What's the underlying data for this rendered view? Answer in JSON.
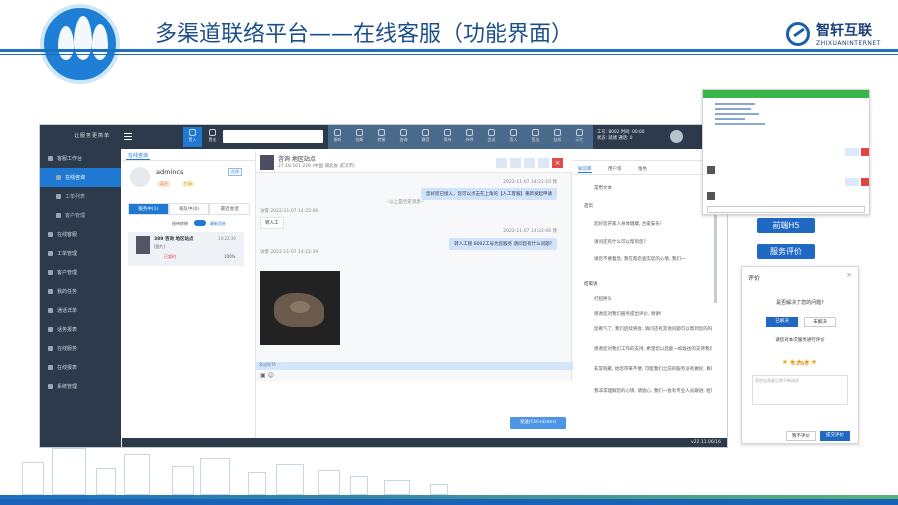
{
  "header": {
    "title": "多渠道联络平台——在线客服（功能界面）",
    "brand_cn": "智轩互联",
    "brand_en": "ZHIXUANINTERNET"
  },
  "app": {
    "brand": "让服务更简单",
    "topbar": {
      "buttons": [
        "置入",
        "置出"
      ],
      "tools": [
        "接听",
        "挂断",
        "转接",
        "咨询",
        "静音",
        "保持",
        "外呼",
        "会议",
        "签入",
        "签出",
        "挂机",
        "示忙"
      ],
      "status_lines": [
        "工号: 8002  时间: 00:00",
        "状态: 就绪  通话: 0"
      ]
    },
    "sidebar": [
      {
        "label": "客服工作台",
        "active": false,
        "sub": false
      },
      {
        "label": "在线咨询",
        "active": true,
        "sub": true
      },
      {
        "label": "工单列表",
        "active": false,
        "sub": true
      },
      {
        "label": "客户管理",
        "active": false,
        "sub": true
      },
      {
        "label": "在线客服",
        "active": false,
        "sub": false
      },
      {
        "label": "工单管理",
        "active": false,
        "sub": false
      },
      {
        "label": "客户管理",
        "active": false,
        "sub": false
      },
      {
        "label": "我的任务",
        "active": false,
        "sub": false
      },
      {
        "label": "通话详单",
        "active": false,
        "sub": false
      },
      {
        "label": "话务报表",
        "active": false,
        "sub": false
      },
      {
        "label": "在线服务",
        "active": false,
        "sub": false
      },
      {
        "label": "在线报表",
        "active": false,
        "sub": false
      },
      {
        "label": "系统管理",
        "active": false,
        "sub": false
      }
    ],
    "tab": "在线咨询",
    "agent": {
      "name": "admincs",
      "tag1": "在线",
      "tag2": "离开",
      "tag3": "忙碌"
    },
    "session_tabs": [
      "服务中(1)",
      "排队中(0)",
      "最近会话"
    ],
    "options": [
      "接待转移",
      "最新消息"
    ],
    "session": {
      "name": "389 咨询 地区站点",
      "time": "14:22:39",
      "preview": "[图片]",
      "status": "已超时",
      "percent": "100%"
    },
    "chat": {
      "visitor": "咨询 地区站点",
      "visitor_info": "27.18.161.229 (中国 湖北省 武汉市)",
      "msgs": [
        {
          "side": "meta-r",
          "text": "2022-11-07 14:21:10  我"
        },
        {
          "side": "r",
          "text": "您好您已接入，您可以点击在上角的【人工客服】重新发起申请"
        },
        {
          "side": "center",
          "text": "--以上是历史消息--"
        },
        {
          "side": "meta-l",
          "text": "访客 2022-11-07 14:22:06"
        },
        {
          "side": "l",
          "text": "转人工"
        },
        {
          "side": "meta-r",
          "text": "2022-11-07 14:22:06  我"
        },
        {
          "side": "r",
          "text": "转人工接 8002工号为您服务 请问您有什么问题?"
        },
        {
          "side": "meta-l",
          "text": "访客 2022-11-07 14:22:39"
        }
      ],
      "input_hint": "发送给TA",
      "send": "发送(Ctrl+Enter)"
    },
    "right": {
      "tabs": [
        "知识库",
        "用户资",
        "角色"
      ],
      "kb": [
        "常用文本",
        "首页",
        "您好您开家人身体健康, 合家安乐!",
        "请问还有什么可以帮到您?",
        "请您不要着急, 我在帮您查实您的心情, 我们一",
        "结束语",
        "打招呼头",
        "感谢您对我们服务提出评价, 谢谢!",
        "您看气了, 我们后续将会, 请问还有其他问题可以帮到您的吗? ?",
        "感谢您对我们工作的支持, 希望您以后能一如既往的支持我们!",
        "非常抱歉, 给您带来不便, 可能我们之前的服务没有做好, 真的很抱歉",
        "我非常理解您的心情, 请放心, 我们一会有专业人员跟进, 给您一个满意的答复"
      ]
    },
    "version": "v22.11.06/16"
  },
  "h5_label": "前端H5",
  "eval_label": "服务评价",
  "eval": {
    "title": "评价",
    "q1": "是否解决了您的问题?",
    "yes": "已解决",
    "no": "未解决",
    "q2": "请您对本次服务进行评价",
    "stars": 5,
    "rating_text": "非常满意",
    "placeholder": "您的宝贵意见将不断改进",
    "cancel": "暂不评价",
    "submit": "提交评价"
  }
}
